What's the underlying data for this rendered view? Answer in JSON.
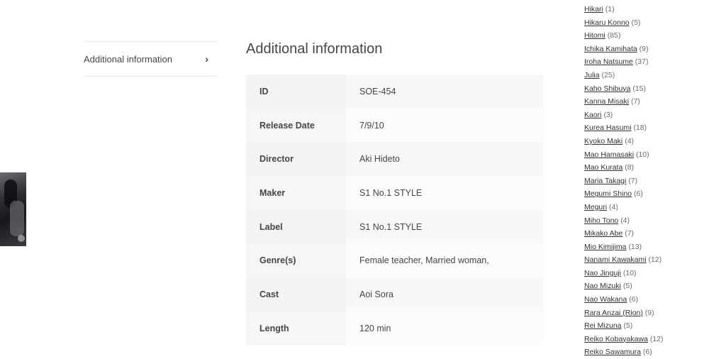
{
  "tabs": [
    {
      "label": "Additional information",
      "icon": "chevron-right-icon"
    }
  ],
  "section": {
    "title": "Additional information"
  },
  "attributes": [
    {
      "key": "ID",
      "value": "SOE-454"
    },
    {
      "key": "Release Date",
      "value": "7/9/10"
    },
    {
      "key": "Director",
      "value": "Aki Hideto"
    },
    {
      "key": "Maker",
      "value": "S1 No.1 STYLE"
    },
    {
      "key": "Label",
      "value": "S1 No.1 STYLE"
    },
    {
      "key": "Genre(s)",
      "value": "Female teacher, Married woman,"
    },
    {
      "key": "Cast",
      "value": "Aoi Sora"
    },
    {
      "key": "Length",
      "value": "120 min"
    }
  ],
  "cast_list": [
    {
      "name": "Hikari",
      "count": "(1)"
    },
    {
      "name": "Hikaru Konno",
      "count": "(5)"
    },
    {
      "name": "Hitomi",
      "count": "(85)"
    },
    {
      "name": "Ichika Kamihata",
      "count": "(9)"
    },
    {
      "name": "Iroha Natsume",
      "count": "(37)"
    },
    {
      "name": "Julia",
      "count": "(25)"
    },
    {
      "name": "Kaho Shibuya",
      "count": "(15)"
    },
    {
      "name": "Kanna Misaki",
      "count": "(7)"
    },
    {
      "name": "Kaori",
      "count": "(3)"
    },
    {
      "name": "Kurea Hasumi",
      "count": "(18)"
    },
    {
      "name": "Kyoko Maki",
      "count": "(4)"
    },
    {
      "name": "Mao Hamasaki",
      "count": "(10)"
    },
    {
      "name": "Mao Kurata",
      "count": "(8)"
    },
    {
      "name": "Maria Takagi",
      "count": "(7)"
    },
    {
      "name": "Megumi Shino",
      "count": "(6)"
    },
    {
      "name": "Meguri",
      "count": "(4)"
    },
    {
      "name": "Miho Tono",
      "count": "(4)"
    },
    {
      "name": "Mikako Abe",
      "count": "(7)"
    },
    {
      "name": "Mio Kimijima",
      "count": "(13)"
    },
    {
      "name": "Nanami Kawakami",
      "count": "(12)"
    },
    {
      "name": "Nao Jinguji",
      "count": "(10)"
    },
    {
      "name": "Nao Mizuki",
      "count": "(5)"
    },
    {
      "name": "Nao Wakana",
      "count": "(6)"
    },
    {
      "name": "Rara Anzai (Rion)",
      "count": "(9)"
    },
    {
      "name": "Rei Mizuna",
      "count": "(5)"
    },
    {
      "name": "Reiko Kobayakawa",
      "count": "(12)"
    },
    {
      "name": "Reiko Sawamura",
      "count": "(6)"
    }
  ]
}
